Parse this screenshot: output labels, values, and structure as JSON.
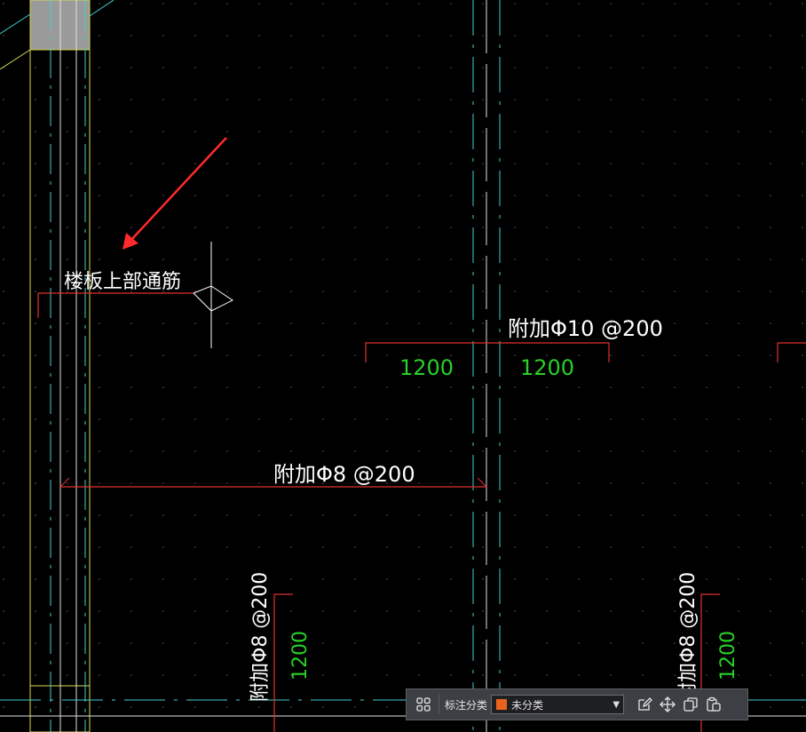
{
  "drawing": {
    "floor_top_rebar_label": "楼板上部通筋",
    "additional_bar_top": "附加Φ10 @200",
    "top_left_length": "1200",
    "top_right_length": "1200",
    "additional_bar_mid": "附加Φ8 @200",
    "vertical_bar_left": "附加Φ8 @200",
    "vertical_left_length": "1200",
    "vertical_bar_right": "附加Φ8 @200",
    "vertical_right_length": "1200"
  },
  "toolbar": {
    "annotation_category_label": "标注分类",
    "category_value": "未分类",
    "category_color": "#e8641e"
  },
  "colors": {
    "background": "#000000",
    "rebar_red": "#e03030",
    "axis_cyan": "#3fd0d0",
    "wall_yellow": "#d8d850",
    "dim_green": "#28d028",
    "text_white": "#ffffff",
    "arrow_red": "#ff2a2a"
  }
}
